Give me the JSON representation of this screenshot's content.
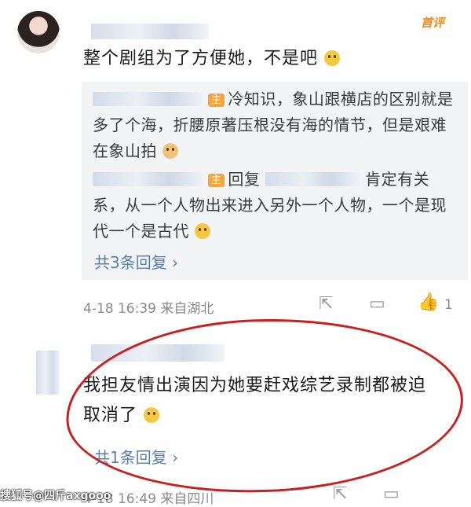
{
  "post": {
    "badge": "首评",
    "comment_text": "整个剧组为了方便她，不是吧",
    "reply1": {
      "tag": "主",
      "text": "冷知识，象山跟横店的区别就是多了个海，折腰原著压根没有海的情节，但是艰难在象山拍"
    },
    "reply2": {
      "tag": "主",
      "reply_word": "回复",
      "text_a": "肯定有",
      "text_b": "关系，从一个人物出来进入另外一个人物，一个是现代一个是古代"
    },
    "more_replies": "共3条回复 ›",
    "meta": "4-18 16:39  来自湖北",
    "like_count": "1"
  },
  "comment2": {
    "text_line1": "我担友情出演因为她要赶戏综艺录制都被迫",
    "text_line2": "取消了",
    "more_replies": "共1条回复 ›",
    "meta": "4-18 16:49  来自四川"
  },
  "watermark": "搜狐号@四斤axgooo"
}
